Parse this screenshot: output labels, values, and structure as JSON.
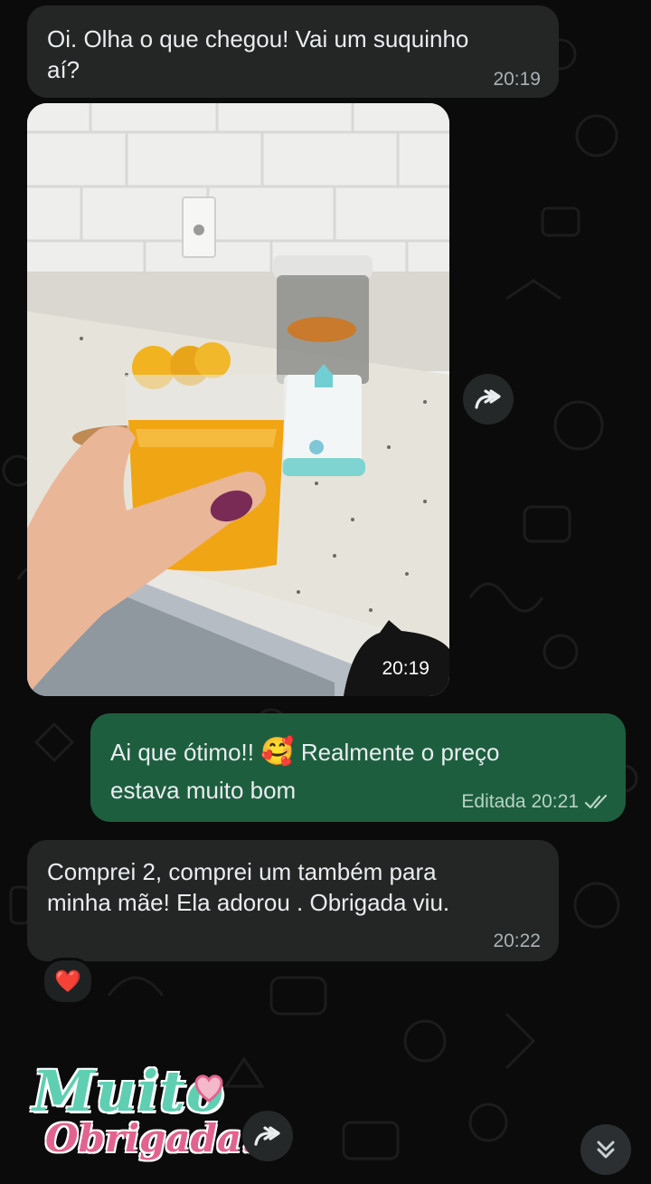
{
  "messages": {
    "m1": {
      "line1": "Oi. Olha o que chegou! Vai um suquinho",
      "line2": "aí?",
      "time": "20:19"
    },
    "photo": {
      "time": "20:19"
    },
    "m2": {
      "line1_a": "Ai que ótimo!!",
      "emoji": "🥰",
      "line1_b": "Realmente o preço",
      "line2": "estava muito bom",
      "time": "Editada 20:21",
      "status_icon": "double-check-icon"
    },
    "m3": {
      "line1": "Comprei 2, comprei um também para",
      "line2": "minha mãe! Ela adorou . Obrigada viu.",
      "time": "20:22",
      "reaction": "❤️"
    },
    "sticker": {
      "word1": "Muito",
      "word2": "Obrigada!"
    }
  },
  "icons": {
    "forward": "forward-icon",
    "scroll_down": "chevrons-down-icon",
    "reaction": "heart-icon"
  },
  "colors": {
    "incoming_bubble": "#242626",
    "outgoing_bubble": "#1d5e3f",
    "background": "#0b0b0b",
    "sticker_teal": "#5fcfb2",
    "sticker_pink": "#e2638f"
  }
}
